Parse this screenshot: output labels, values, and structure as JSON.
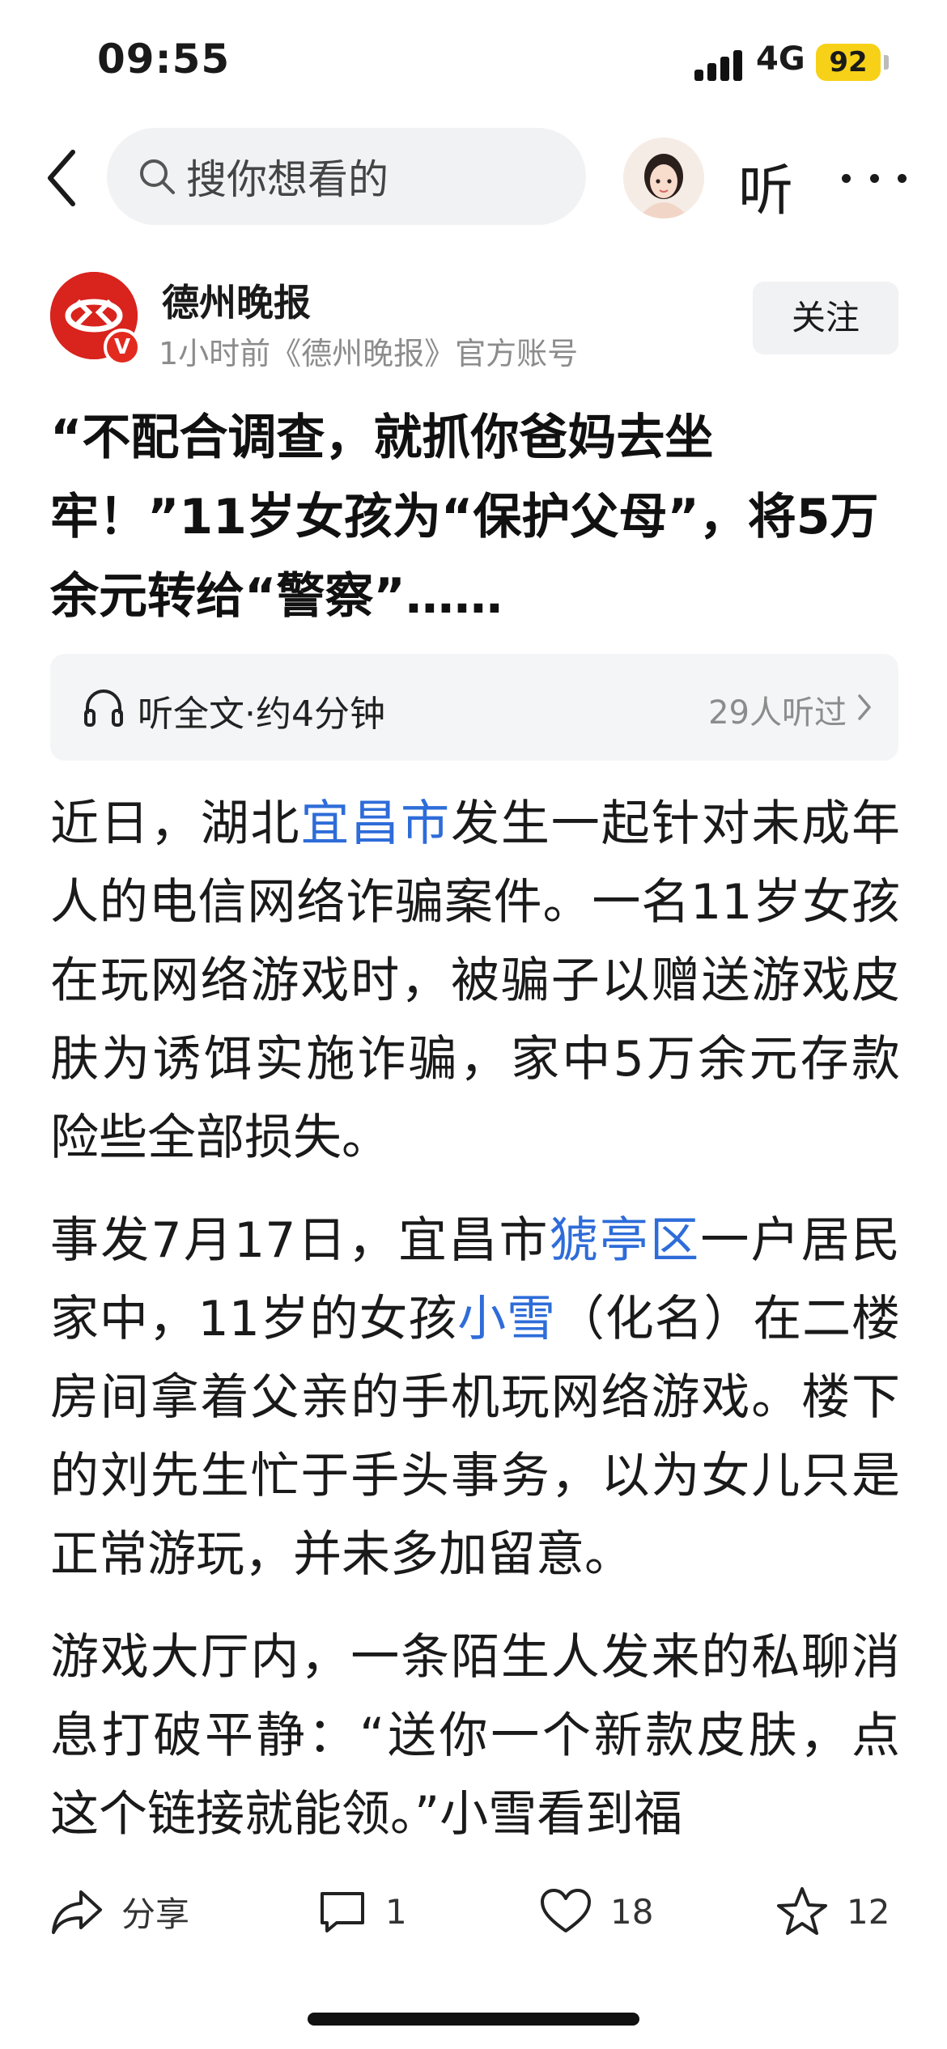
{
  "status_bar": {
    "time": "09:55",
    "network": "4G",
    "battery": "92",
    "battery_color": "#f7d117"
  },
  "nav": {
    "back_icon": "chevron-left-icon",
    "search_placeholder": "搜你想看的",
    "listen_label": "听",
    "more_icon": "more-horizontal-icon"
  },
  "author": {
    "name": "德州晚报",
    "meta": "1小时前《德州晚报》官方账号",
    "verified_label": "V",
    "follow_label": "关注",
    "logo_color": "#d9231d"
  },
  "article": {
    "headline": "“不配合调查，就抓你爸妈去坐牢！”11岁女孩为“保护父母”，将5万余元转给“警察”……",
    "listen_bar": {
      "label": "听全文·约4分钟",
      "count": "29人听过"
    },
    "paragraphs": [
      {
        "segments": [
          {
            "text": "近日，湖北",
            "link": false
          },
          {
            "text": "宜昌市",
            "link": true
          },
          {
            "text": "发生一起针对未成年人的电信网络诈骗案件。一名11岁女孩在玩网络游戏时，被骗子以赠送游戏皮肤为诱饵实施诈骗，家中5万余元存款险些全部损失。",
            "link": false
          }
        ]
      },
      {
        "segments": [
          {
            "text": "事发7月17日，宜昌市",
            "link": false
          },
          {
            "text": "猇亭区",
            "link": true
          },
          {
            "text": "一户居民家中，11岁的女孩",
            "link": false
          },
          {
            "text": "小雪",
            "link": true
          },
          {
            "text": "（化名）在二楼房间拿着父亲的手机玩网络游戏。楼下的刘先生忙于手头事务，以为女儿只是正常游玩，并未多加留意。",
            "link": false
          }
        ]
      },
      {
        "segments": [
          {
            "text": "游戏大厅内，一条陌生人发来的私聊消息打破平静：“送你一个新款皮肤，点这个链接就能领。”小雪看到福",
            "link": false
          }
        ]
      }
    ],
    "link_color": "#2e6cd9"
  },
  "actions": {
    "share_label": "分享",
    "comment_count": "1",
    "like_count": "18",
    "favorite_count": "12"
  }
}
